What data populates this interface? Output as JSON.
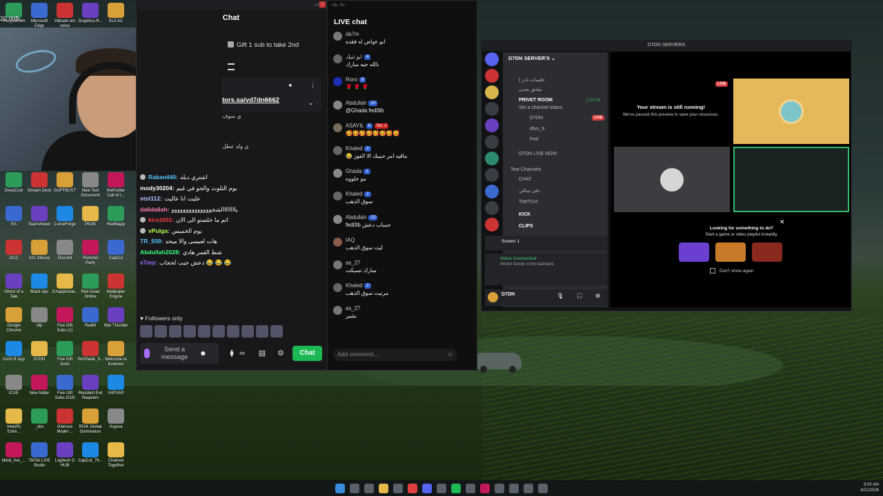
{
  "desktop": {
    "top_row_icons": [
      "Recycle Bin",
      "Microsoft Edge",
      "Vidrado em voice",
      "Graphics-R...",
      "SLS AC"
    ],
    "overlay_text": "20.00$ ...",
    "icons_col1": [
      "DeepCool",
      "EA",
      "GCC",
      "Ghost of a Tale",
      "Google Chrome",
      "GoXLR App",
      "iCUE",
      "Intel(R) Extre...",
      "tiktok_live_..."
    ],
    "icons_col2": [
      "Stream Deck",
      "TeamViewer",
      "X11 Mouse",
      "Black ops",
      "clip",
      "D7DN",
      "New folder",
      "_obs",
      "TikTok LIVE Studio"
    ],
    "icons_col3": [
      "GUFFBUST",
      "CurseForge",
      "Discord",
      "EAappinstal...",
      "Five Gift Subs (1)",
      "Five Gift Subs",
      "Five Gift Subs-2025",
      "Glorious Model ...",
      "Logitech G HUB"
    ],
    "icons_col4": [
      "New Text Document",
      "PEAK",
      "Pummel Party",
      "Red Dead Online",
      "RedM",
      "ReShade_S...",
      "Resident Evil Requiem",
      "RISK Global Domination",
      "CapCut_76..."
    ],
    "icons_col5": [
      "theHunter Call of t...",
      "RedMapp",
      "CapCut",
      "Wallpaper Engine",
      "War Thunder",
      "Welcome to Kowloon",
      "V4PVAP",
      "Argova",
      "Chained Together"
    ]
  },
  "chat_panel": {
    "titlebar": "شات",
    "header": "Chat",
    "gift_text": "Gift 1 sub to take 2nd",
    "pinned_link": "tors.sa/vd7dn6662",
    "pinned_arabic_1": "ي سوف",
    "pinned_arabic_2": "ي ولد عطل",
    "messages": [
      {
        "user": "Rakan440:",
        "text": "اشتري دبله",
        "color": "#56c8ff"
      },
      {
        "user": "mody30204:",
        "text": "يوم الثلوث والجو في غيم",
        "color": "#ffffff"
      },
      {
        "user": "stst112:",
        "text": "عليت انا عاليت",
        "color": "#b4c4ff"
      },
      {
        "user": "da6da6ah:",
        "text": "ياااااااالشجوووووووووووووو",
        "color": "#ff7fb3"
      },
      {
        "user": "kira1651:",
        "text": "اتم ما خلصتو الى الان",
        "color": "#ff3b3b"
      },
      {
        "user": "vPulga:",
        "text": "يوم الخميس",
        "color": "#b8ff4f"
      },
      {
        "user": "TR_939:",
        "text": "هات لعيسى والا ميحد",
        "color": "#56c8ff"
      },
      {
        "user": "Abdullah2028:",
        "text": "شط القمر هادي",
        "color": "#3cff7a"
      },
      {
        "user": "e7my:",
        "text": "دعش جيب لحجاب 😂 😂 😂",
        "color": "#a970ff"
      }
    ],
    "followers_label": "Followers only",
    "send_placeholder": "Send a message",
    "chat_button": "Chat"
  },
  "live_chat": {
    "titlebar": "تيك توك",
    "title": "LIVE chat",
    "messages": [
      {
        "name": "da7m",
        "badge": "",
        "text": "ابو عواض له فقده",
        "avatar": "#777"
      },
      {
        "name": "ابو ثنيك",
        "badge": "4",
        "text": "بالله حيه مبارك",
        "avatar": "#666"
      },
      {
        "name": "Roro",
        "badge": "8",
        "text": "🌹 🌹 🌹",
        "avatar": "#1b2fb0"
      },
      {
        "name": "Abdullah",
        "badge": "10",
        "text": "@Ghada fed0tb",
        "avatar": "#888"
      },
      {
        "name": "ASAYIL",
        "badge": "6",
        "badge2": "No. 2",
        "text": "🥰🥰🥰🥰🥰🥰🥰🥰",
        "avatar": "#7a6a5a"
      },
      {
        "name": "Khaled",
        "badge": "2",
        "text": "ماقيه امر حبيبك الا الفوز 😂",
        "avatar": "#666"
      },
      {
        "name": "Ghada",
        "badge": "1",
        "text": "مو حلووه",
        "avatar": "#888"
      },
      {
        "name": "Khaled",
        "badge": "2",
        "text": "سوق الذهب",
        "avatar": "#666"
      },
      {
        "name": "Abdullah",
        "badge": "10",
        "text": "fed0tb حساب دعش",
        "avatar": "#888"
      },
      {
        "name": "IAQ",
        "badge": "",
        "text": "ليت سوق الذهب",
        "avatar": "#8a5a4a"
      },
      {
        "name": "as_27",
        "badge": "",
        "text": "مبارك نسيكت",
        "avatar": "#777"
      },
      {
        "name": "Khaled",
        "badge": "2",
        "text": "مرنيت سوق الذهب",
        "avatar": "#666"
      },
      {
        "name": "as_27",
        "badge": "",
        "text": "بشير",
        "avatar": "#777"
      }
    ],
    "comment_placeholder": "Add comment..."
  },
  "discord": {
    "title": "D7DN SERVERS",
    "server_name": "D7DN SERVER'S",
    "channels": [
      {
        "label": "| جلسات نادر",
        "bold": false
      },
      {
        "label": "ملحق نحدن",
        "bold": false
      },
      {
        "label": "PRIVET ROOM",
        "bold": true
      },
      {
        "label": "Set a channel status",
        "bold": false
      },
      {
        "label": "D7DN",
        "bold": false
      },
      {
        "label": "dhm_9",
        "bold": false
      },
      {
        "label": "Fed",
        "bold": false
      },
      {
        "label": "D7DN LIVE NOW",
        "bold": false
      },
      {
        "label": "Text Channels",
        "bold": false
      },
      {
        "label": "CHAT",
        "bold": false
      },
      {
        "label": "حلى-سالي",
        "bold": false
      },
      {
        "label": "TWITCH",
        "bold": false
      },
      {
        "label": "KICK",
        "bold": true
      },
      {
        "label": "CLIPS",
        "bold": true
      }
    ],
    "room_time": "2:25:08",
    "live_badge": "LIVE",
    "stream_running": "Your stream is still running!",
    "stream_paused": "We've paused this preview to save your resources.",
    "screen_label": "Screen 1",
    "voice_connected": "Voice Connected",
    "voice_room": "PRIVET ROOM / D7DN SERVERS",
    "look_title": "Looking for something to do?",
    "look_sub": "Start a game or video playlist instantly.",
    "dont_show": "Don't show again",
    "user_name": "D7DN"
  },
  "taskbar": {
    "time": "9:00 AM",
    "date": "4/21/2026"
  }
}
